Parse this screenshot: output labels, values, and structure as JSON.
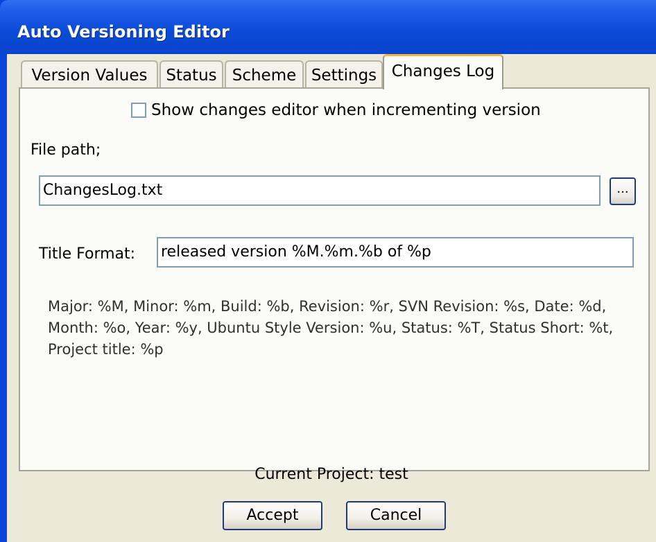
{
  "window": {
    "title": "Auto Versioning Editor"
  },
  "tabs": [
    {
      "label": "Version Values"
    },
    {
      "label": "Status"
    },
    {
      "label": "Scheme"
    },
    {
      "label": "Settings"
    },
    {
      "label": "Changes Log",
      "active": true
    }
  ],
  "changes_log": {
    "show_editor_checkbox": {
      "label": "Show changes editor when incrementing version",
      "checked": false
    },
    "file_path_label": "File path;",
    "file_path_value": "ChangesLog.txt",
    "browse_label": "...",
    "title_format_label": "Title Format:",
    "title_format_value": "released version %M.%m.%b of %p",
    "help_text": "Major: %M, Minor: %m, Build: %b, Revision: %r, SVN Revision: %s, Date: %d, Month: %o, Year: %y, Ubuntu Style Version: %u, Status: %T, Status Short: %t, Project title: %p"
  },
  "footer": {
    "current_project": "Current Project: test",
    "accept_label": "Accept",
    "cancel_label": "Cancel"
  }
}
